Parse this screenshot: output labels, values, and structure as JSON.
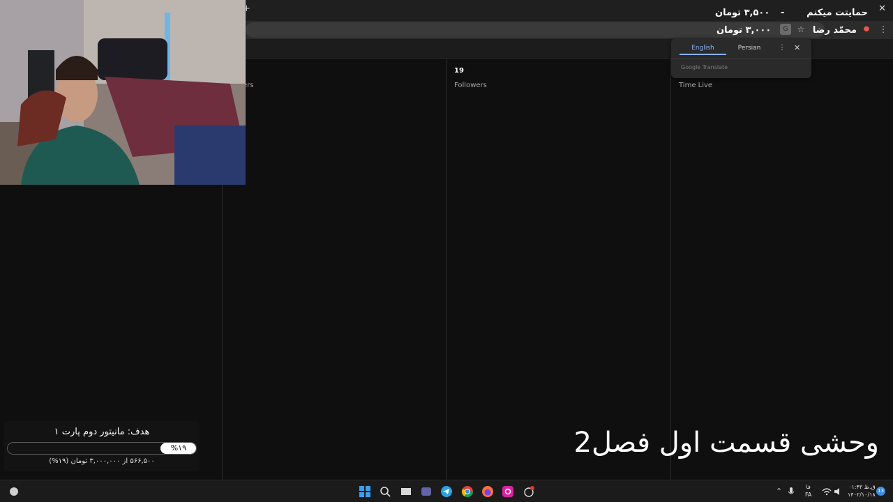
{
  "colors": {
    "background": "#0f0f0f",
    "chrome_dark": "#1f1f1f",
    "accent_blue": "#8ab4f8",
    "text_white": "#ffffff"
  },
  "browser": {
    "new_tab_glyph": "+",
    "close_glyph": "✕",
    "icons": [
      "translate-icon",
      "star-icon",
      "profile-icon",
      "menu-icon"
    ]
  },
  "stats": [
    {
      "value": "",
      "label": "ers"
    },
    {
      "value": "19",
      "label": "Followers"
    },
    {
      "value": "",
      "label": "Time Live"
    }
  ],
  "donations": [
    {
      "name": "حمایتت میکنم",
      "separator": "-",
      "amount": "۳,۵۰۰ تومان"
    },
    {
      "name": "محمّد رضا",
      "amount": "۳,۰۰۰ تومان"
    }
  ],
  "translate_popup": {
    "tab_english": "English",
    "tab_persian": "Persian",
    "brand": "Google Translate"
  },
  "goal": {
    "title": "هدف: مانیتور دوم پارت ۱",
    "percent_label": "%۱۹",
    "progress_fraction": 0.19,
    "subtitle": "۵۶۶,۵۰۰ از ۳,۰۰۰,۰۰۰ تومان (۱۹%)"
  },
  "episode_title": "وحشی قسمت اول فصل2",
  "taskbar": {
    "language_top": "فا",
    "language_bottom": "FA",
    "time": "۰۱:۴۳ ق.ظ",
    "date": "۱۴۰۲/۱۰/۱۸",
    "notifications": "13",
    "apps": [
      "start-icon",
      "search-icon",
      "task-view-icon",
      "teams-icon",
      "telegram-icon",
      "chrome-icon",
      "firefox-icon",
      "instagram-icon",
      "app-icon"
    ]
  }
}
